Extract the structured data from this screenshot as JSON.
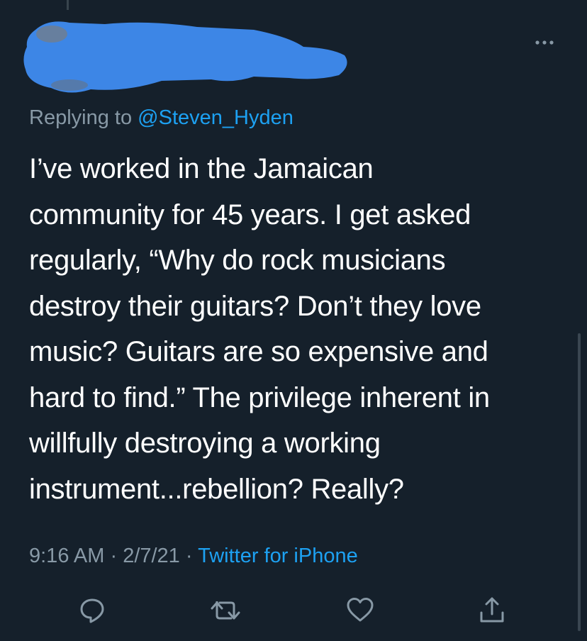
{
  "reply": {
    "prefix": "Replying to ",
    "handle": "@Steven_Hyden"
  },
  "tweet": {
    "lines": [
      "I’ve worked in the Jamaican",
      "community for 45 years. I get asked",
      "regularly, “Why do rock musicians",
      "destroy their guitars? Don’t they love",
      "music? Guitars are so expensive and",
      "hard to find.” The privilege inherent in",
      "willfully destroying a working",
      "instrument...rebellion? Really?"
    ]
  },
  "meta": {
    "time": "9:16 AM",
    "sep1": " · ",
    "date": "2/7/21",
    "sep2": " · ",
    "source": "Twitter for iPhone"
  },
  "icons": {
    "more": "more-horizontal-icon",
    "reply": "reply-icon",
    "retweet": "retweet-icon",
    "like": "heart-icon",
    "share": "share-icon"
  },
  "colors": {
    "background": "#15202b",
    "text": "#ffffff",
    "secondary": "#8899a6",
    "accent": "#1da1f2",
    "redaction": "#3d86e6"
  }
}
